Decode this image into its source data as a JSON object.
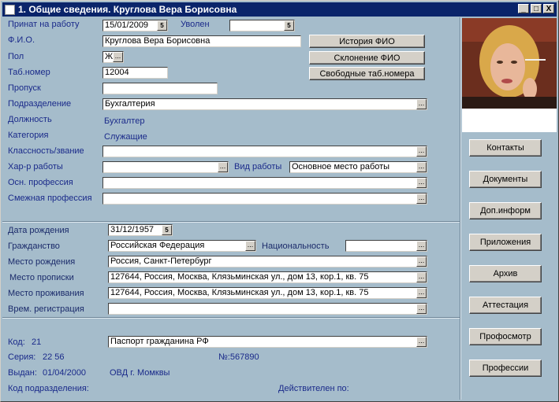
{
  "window": {
    "title": "1. Общие сведения. Круглова Вера Борисовна",
    "minimize_glyph": "_",
    "maximize_glyph": "□",
    "close_glyph": "X"
  },
  "form": {
    "hired_label": "Принат на работу",
    "hired_value": "15/01/2009",
    "fired_label": "Уволен",
    "fired_value": "",
    "fio_label": "Ф.И.О.",
    "fio_value": "Круглова Вера Борисовна",
    "sex_label": "Пол",
    "sex_value": "Ж",
    "tabnum_label": "Таб.номер",
    "tabnum_value": "12004",
    "pass_label": "Пропуск",
    "pass_value": "",
    "dept_label": "Подразделение",
    "dept_value": "Бухгалтерия",
    "position_label": "Должность",
    "position_value": "Бухгалтер",
    "category_label": "Категория",
    "category_value": "Служащие",
    "class_label": "Классность/звание",
    "class_value": "",
    "worktype_label": "Хар-р работы",
    "worktype_value": "",
    "workkind_label": "Вид работы",
    "workkind_value": "Основное место работы",
    "mainprof_label": "Осн. профессия",
    "mainprof_value": "",
    "relprof_label": "Смежная профессия",
    "relprof_value": ""
  },
  "buttons": {
    "history_fio": "История   ФИО",
    "decline_fio": "Склонение ФИО",
    "free_tabnums": "Свободные таб.номера",
    "ellipsis": "...",
    "calendar": "5"
  },
  "personal": {
    "birth_label": "Дата рождения",
    "birth_value": "31/12/1957",
    "citizenship_label": "Гражданство",
    "citizenship_value": "Российская Федерация",
    "nationality_label": "Национальность",
    "nationality_value": "",
    "birthplace_label": "Место рождения",
    "birthplace_value": "Россия, Санкт-Петербург",
    "registration_label": "Место прописки",
    "registration_value": "127644, Россия, Москва, Клязьминская ул., дом 13, кор.1, кв. 75",
    "residence_label": "Место проживания",
    "residence_value": "127644, Россия, Москва, Клязьминская ул., дом 13, кор.1, кв. 75",
    "tempreg_label": "Врем. регистрация",
    "tempreg_value": ""
  },
  "document": {
    "code_label": "Код:",
    "code_value": "21",
    "doc_name": "Паспорт гражданина РФ",
    "series_label": "Серия:",
    "series_value": "22 56",
    "number_text": "№:567890",
    "issued_label": "Выдан:",
    "issued_date": "01/04/2000",
    "issued_by": "ОВД г. Момквы",
    "subdiv_label": "Код подразделения:",
    "valid_label": "Действителен по:"
  },
  "side_buttons": [
    "Контакты",
    "Документы",
    "Доп.информ",
    "Приложения",
    "Архив",
    "Аттестация",
    "Профосмотр",
    "Профессии"
  ]
}
